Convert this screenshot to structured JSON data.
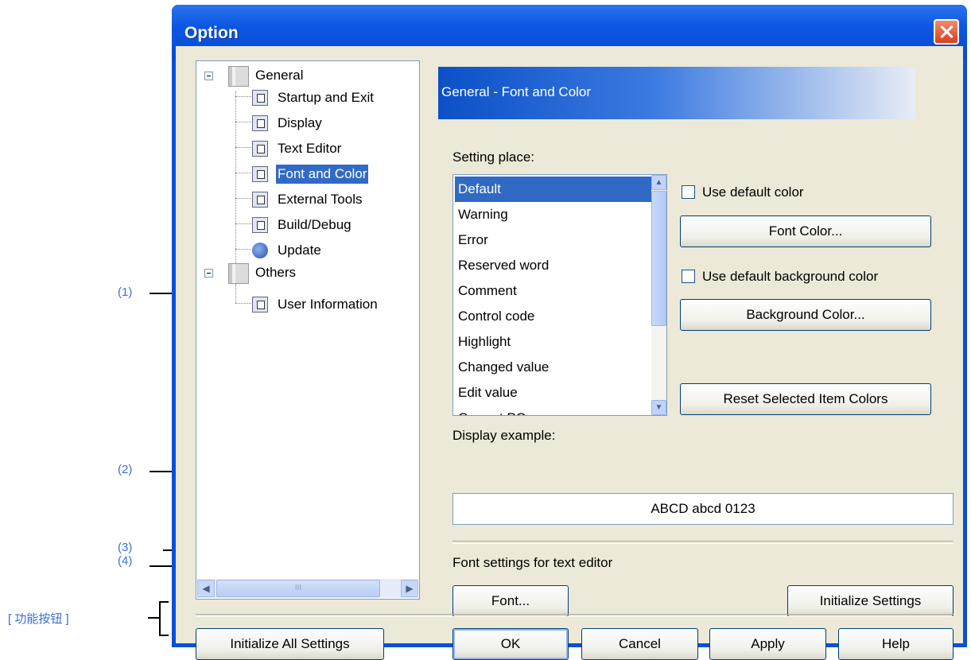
{
  "window": {
    "title": "Option"
  },
  "tree": {
    "items": [
      {
        "label": "General",
        "kind": "folder"
      },
      {
        "label": "Startup and Exit",
        "kind": "page"
      },
      {
        "label": "Display",
        "kind": "page"
      },
      {
        "label": "Text Editor",
        "kind": "page"
      },
      {
        "label": "Font and Color",
        "kind": "page",
        "selected": true
      },
      {
        "label": "External Tools",
        "kind": "page"
      },
      {
        "label": "Build/Debug",
        "kind": "page"
      },
      {
        "label": "Update",
        "kind": "update"
      },
      {
        "label": "Others",
        "kind": "folder"
      },
      {
        "label": "User Information",
        "kind": "page"
      }
    ],
    "hscroll_thumb_glyph": "III"
  },
  "page": {
    "header": "General - Font and Color",
    "setting_place_label": "Setting place:",
    "setting_place_items": [
      "Default",
      "Warning",
      "Error",
      "Reserved word",
      "Comment",
      "Control code",
      "Highlight",
      "Changed value",
      "Edit value",
      "Current PC"
    ],
    "use_default_color": "Use default color",
    "font_color_button": "Font Color...",
    "use_default_bg_color": "Use default background color",
    "background_color_button": "Background Color...",
    "reset_colors_button": "Reset Selected Item Colors",
    "display_example_label": "Display example:",
    "display_example_text": "ABCD abcd 0123",
    "font_settings_label": "Font settings for text editor",
    "font_button": "Font...",
    "initialize_settings_button": "Initialize Settings"
  },
  "footer": {
    "initialize_all_button": "Initialize All Settings",
    "ok_button": "OK",
    "cancel_button": "Cancel",
    "apply_button": "Apply",
    "help_button": "Help"
  },
  "annotations": {
    "a1": "(1)",
    "a2": "(2)",
    "a3": "(3)",
    "a4": "(4)",
    "func_buttons": "[ 功能按钮 ]"
  },
  "colors": {
    "titlebar": "#0a4fd8",
    "dialog_face": "#ece9d8",
    "selection": "#316ac5",
    "annotation": "#3a6fd8"
  }
}
